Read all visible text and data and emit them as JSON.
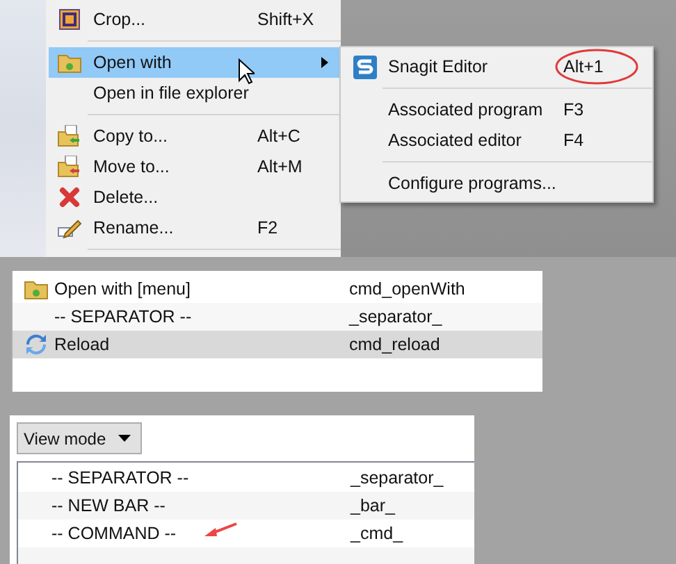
{
  "context_menu": {
    "items": [
      {
        "kind": "item",
        "label": "Crop...",
        "shortcut": "Shift+X",
        "selected": false,
        "has_submenu": false
      },
      {
        "kind": "separator"
      },
      {
        "kind": "item",
        "label": "Open with",
        "selected": true,
        "has_submenu": true
      },
      {
        "kind": "item",
        "label": "Open in file explorer",
        "selected": false,
        "has_submenu": false
      },
      {
        "kind": "separator"
      },
      {
        "kind": "item",
        "label": "Copy to...",
        "shortcut": "Alt+C",
        "selected": false,
        "has_submenu": false
      },
      {
        "kind": "item",
        "label": "Move to...",
        "shortcut": "Alt+M",
        "selected": false,
        "has_submenu": false
      },
      {
        "kind": "item",
        "label": "Delete...",
        "selected": false,
        "has_submenu": false
      },
      {
        "kind": "item",
        "label": "Rename...",
        "shortcut": "F2",
        "selected": false,
        "has_submenu": false
      },
      {
        "kind": "separator"
      }
    ]
  },
  "submenu": {
    "items": [
      {
        "kind": "item",
        "label": "Snagit Editor",
        "shortcut": "Alt+1",
        "circled": true
      },
      {
        "kind": "separator"
      },
      {
        "kind": "item",
        "label": "Associated program",
        "shortcut": "F3",
        "circled": false
      },
      {
        "kind": "item",
        "label": "Associated editor",
        "shortcut": "F4",
        "circled": false
      },
      {
        "kind": "separator"
      },
      {
        "kind": "item",
        "label": "Configure programs...",
        "circled": false
      }
    ]
  },
  "command_list": {
    "rows": [
      {
        "label": "Open with [menu]",
        "command": "cmd_openWith",
        "selected": false
      },
      {
        "label": "-- SEPARATOR --",
        "command": "_separator_",
        "selected": false
      },
      {
        "label": "Reload",
        "command": "cmd_reload",
        "selected": true
      }
    ]
  },
  "toolbar_editor": {
    "view_mode": "View mode",
    "rows": [
      {
        "label": "-- SEPARATOR --",
        "command": "_separator_",
        "pointed": false
      },
      {
        "label": "-- NEW BAR --",
        "command": "_bar_",
        "pointed": false
      },
      {
        "label": "-- COMMAND --",
        "command": "_cmd_",
        "pointed": true
      }
    ]
  }
}
